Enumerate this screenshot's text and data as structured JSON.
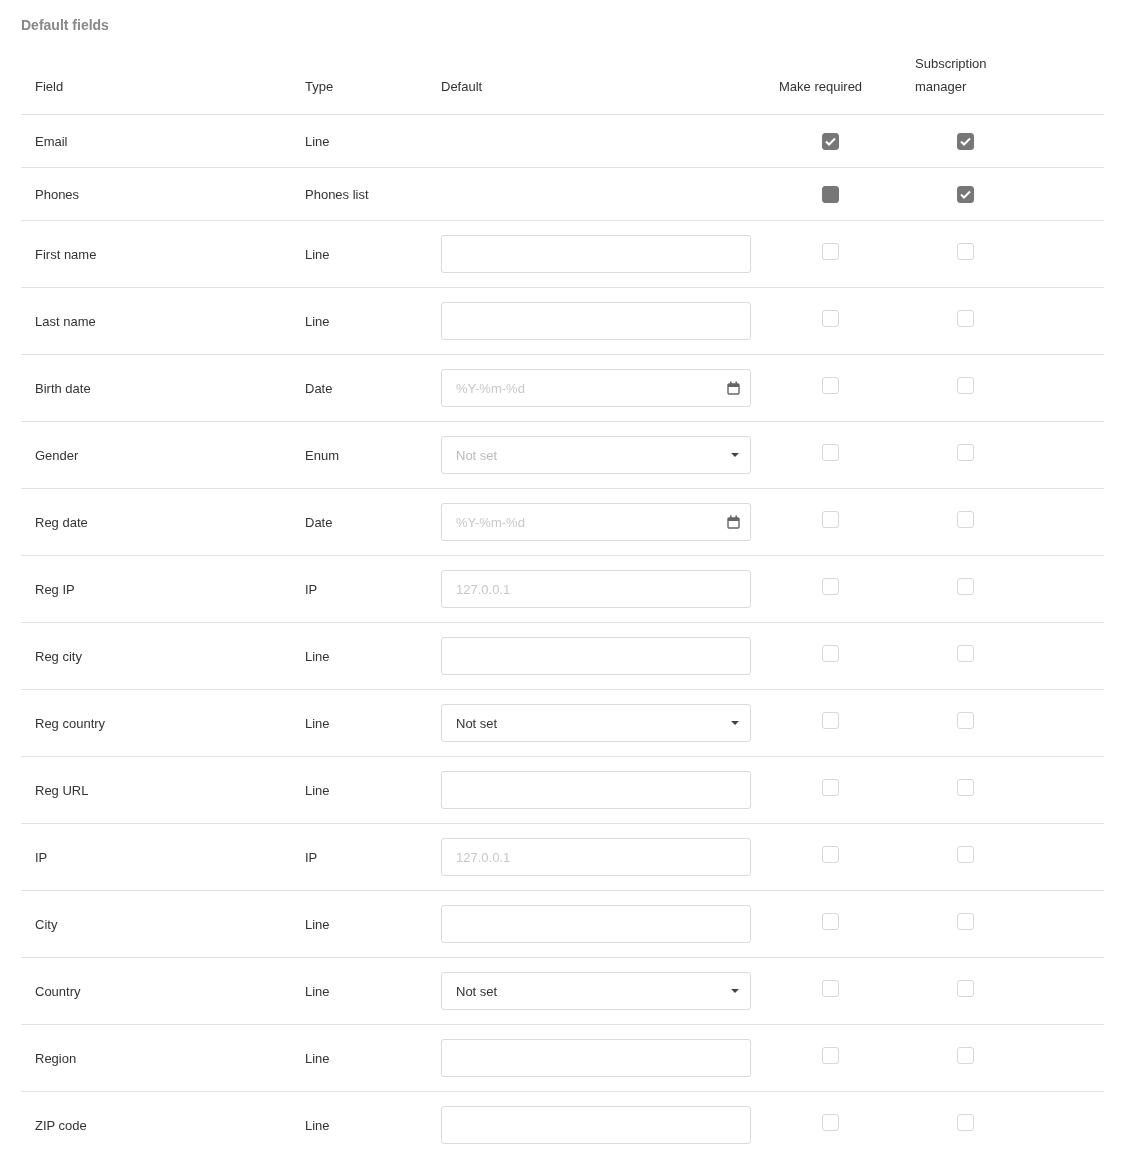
{
  "title": "Default fields",
  "columns": [
    "Field",
    "Type",
    "Default",
    "Make required",
    "Subscription manager"
  ],
  "rows": [
    {
      "field": "Email",
      "type": "Line",
      "required": {
        "checked": true,
        "disabled": true
      },
      "subscription": {
        "checked": true,
        "disabled": true
      }
    },
    {
      "field": "Phones",
      "type": "Phones list",
      "required": {
        "checked": false,
        "disabled": true
      },
      "subscription": {
        "checked": true,
        "disabled": true
      }
    },
    {
      "field": "First name",
      "type": "Line",
      "default": {
        "kind": "text"
      },
      "required": {
        "checked": false,
        "disabled": false
      },
      "subscription": {
        "checked": false,
        "disabled": false
      }
    },
    {
      "field": "Last name",
      "type": "Line",
      "default": {
        "kind": "text"
      },
      "required": {
        "checked": false,
        "disabled": false
      },
      "subscription": {
        "checked": false,
        "disabled": false
      }
    },
    {
      "field": "Birth date",
      "type": "Date",
      "default": {
        "kind": "date",
        "placeholder": "%Y-%m-%d"
      },
      "required": {
        "checked": false,
        "disabled": false
      },
      "subscription": {
        "checked": false,
        "disabled": false
      }
    },
    {
      "field": "Gender",
      "type": "Enum",
      "default": {
        "kind": "select",
        "placeholder": "Not set"
      },
      "required": {
        "checked": false,
        "disabled": false
      },
      "subscription": {
        "checked": false,
        "disabled": false
      }
    },
    {
      "field": "Reg date",
      "type": "Date",
      "default": {
        "kind": "date",
        "placeholder": "%Y-%m-%d"
      },
      "required": {
        "checked": false,
        "disabled": false
      },
      "subscription": {
        "checked": false,
        "disabled": false
      }
    },
    {
      "field": "Reg IP",
      "type": "IP",
      "default": {
        "kind": "text",
        "placeholder": "127.0.0.1"
      },
      "required": {
        "checked": false,
        "disabled": false
      },
      "subscription": {
        "checked": false,
        "disabled": false
      }
    },
    {
      "field": "Reg city",
      "type": "Line",
      "default": {
        "kind": "text"
      },
      "required": {
        "checked": false,
        "disabled": false
      },
      "subscription": {
        "checked": false,
        "disabled": false
      }
    },
    {
      "field": "Reg country",
      "type": "Line",
      "default": {
        "kind": "select",
        "value": "Not set"
      },
      "required": {
        "checked": false,
        "disabled": false
      },
      "subscription": {
        "checked": false,
        "disabled": false
      }
    },
    {
      "field": "Reg URL",
      "type": "Line",
      "default": {
        "kind": "text"
      },
      "required": {
        "checked": false,
        "disabled": false
      },
      "subscription": {
        "checked": false,
        "disabled": false
      }
    },
    {
      "field": "IP",
      "type": "IP",
      "default": {
        "kind": "text",
        "placeholder": "127.0.0.1"
      },
      "required": {
        "checked": false,
        "disabled": false
      },
      "subscription": {
        "checked": false,
        "disabled": false
      }
    },
    {
      "field": "City",
      "type": "Line",
      "default": {
        "kind": "text"
      },
      "required": {
        "checked": false,
        "disabled": false
      },
      "subscription": {
        "checked": false,
        "disabled": false
      }
    },
    {
      "field": "Country",
      "type": "Line",
      "default": {
        "kind": "select",
        "value": "Not set"
      },
      "required": {
        "checked": false,
        "disabled": false
      },
      "subscription": {
        "checked": false,
        "disabled": false
      }
    },
    {
      "field": "Region",
      "type": "Line",
      "default": {
        "kind": "text"
      },
      "required": {
        "checked": false,
        "disabled": false
      },
      "subscription": {
        "checked": false,
        "disabled": false
      }
    },
    {
      "field": "ZIP code",
      "type": "Line",
      "default": {
        "kind": "text"
      },
      "required": {
        "checked": false,
        "disabled": false
      },
      "subscription": {
        "checked": false,
        "disabled": false
      }
    }
  ]
}
